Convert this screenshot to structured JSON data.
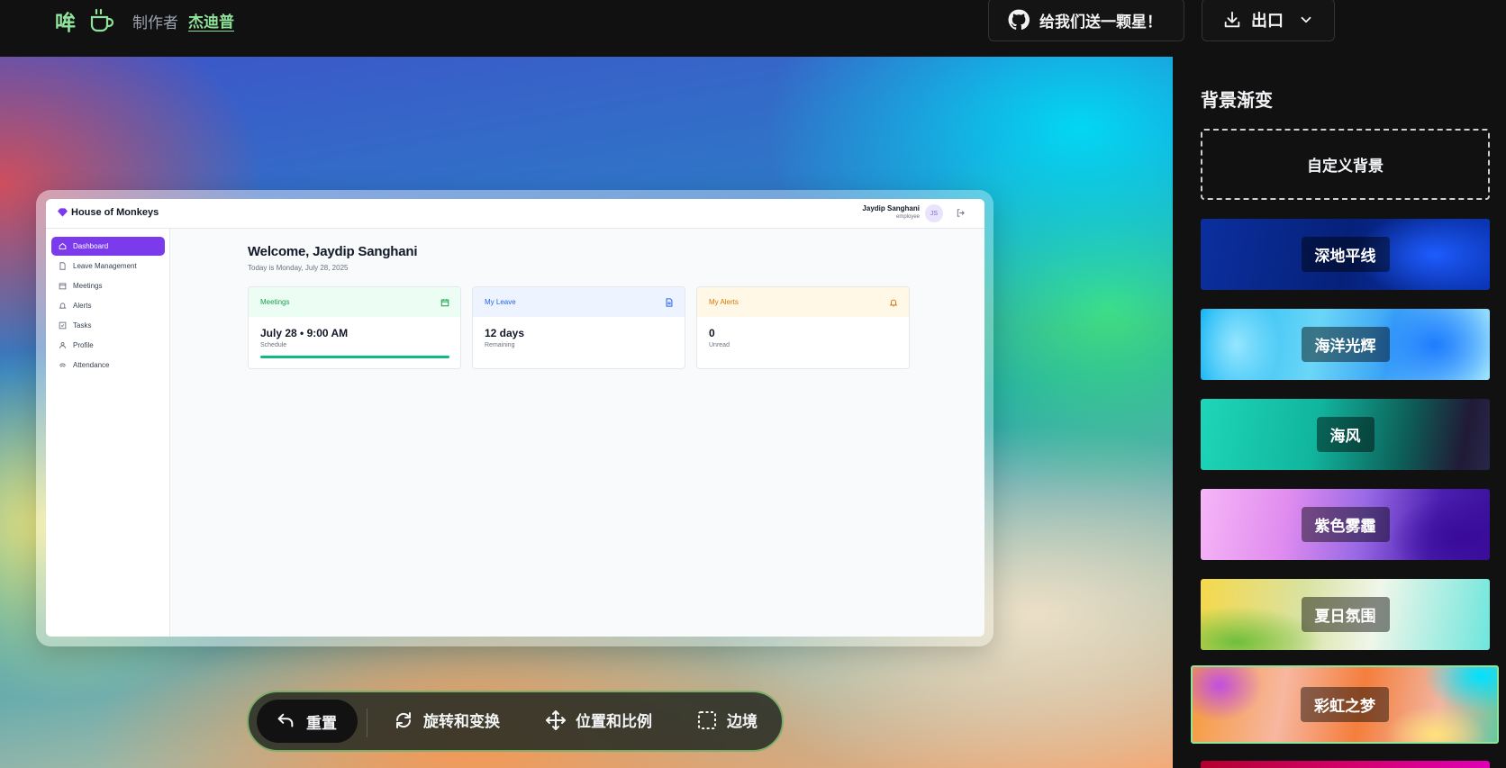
{
  "topbar": {
    "logo": "哞",
    "made_by": "制作者",
    "author": "杰迪普",
    "star_button": "给我们送一颗星！",
    "export_button": "出口"
  },
  "mock_app": {
    "brand": "House of Monkeys",
    "user_name": "Jaydip Sanghani",
    "user_role": "employee",
    "avatar_initials": "JS",
    "nav": [
      {
        "label": "Dashboard",
        "active": true
      },
      {
        "label": "Leave Management"
      },
      {
        "label": "Meetings"
      },
      {
        "label": "Alerts"
      },
      {
        "label": "Tasks"
      },
      {
        "label": "Profile"
      },
      {
        "label": "Attendance"
      }
    ],
    "welcome": "Welcome, Jaydip Sanghani",
    "today": "Today is Monday, July 28, 2025",
    "cards": [
      {
        "title": "Meetings",
        "value": "July 28 • 9:00 AM",
        "sub": "Schedule",
        "color": "#16a34a",
        "bg": "#ecfdf3"
      },
      {
        "title": "My Leave",
        "value": "12 days",
        "sub": "Remaining",
        "color": "#2563eb",
        "bg": "#eef4ff"
      },
      {
        "title": "My Alerts",
        "value": "0",
        "sub": "Unread",
        "color": "#d97706",
        "bg": "#fff8e6"
      }
    ]
  },
  "toolbar": {
    "reset": "重置",
    "rotate": "旋转和变换",
    "position": "位置和比例",
    "border": "边境"
  },
  "panel": {
    "title": "背景渐变",
    "custom": "自定义背景",
    "gradients": [
      "深地平线",
      "海洋光辉",
      "海风",
      "紫色雾霾",
      "夏日氛围",
      "彩虹之梦"
    ],
    "selected": "彩虹之梦"
  }
}
